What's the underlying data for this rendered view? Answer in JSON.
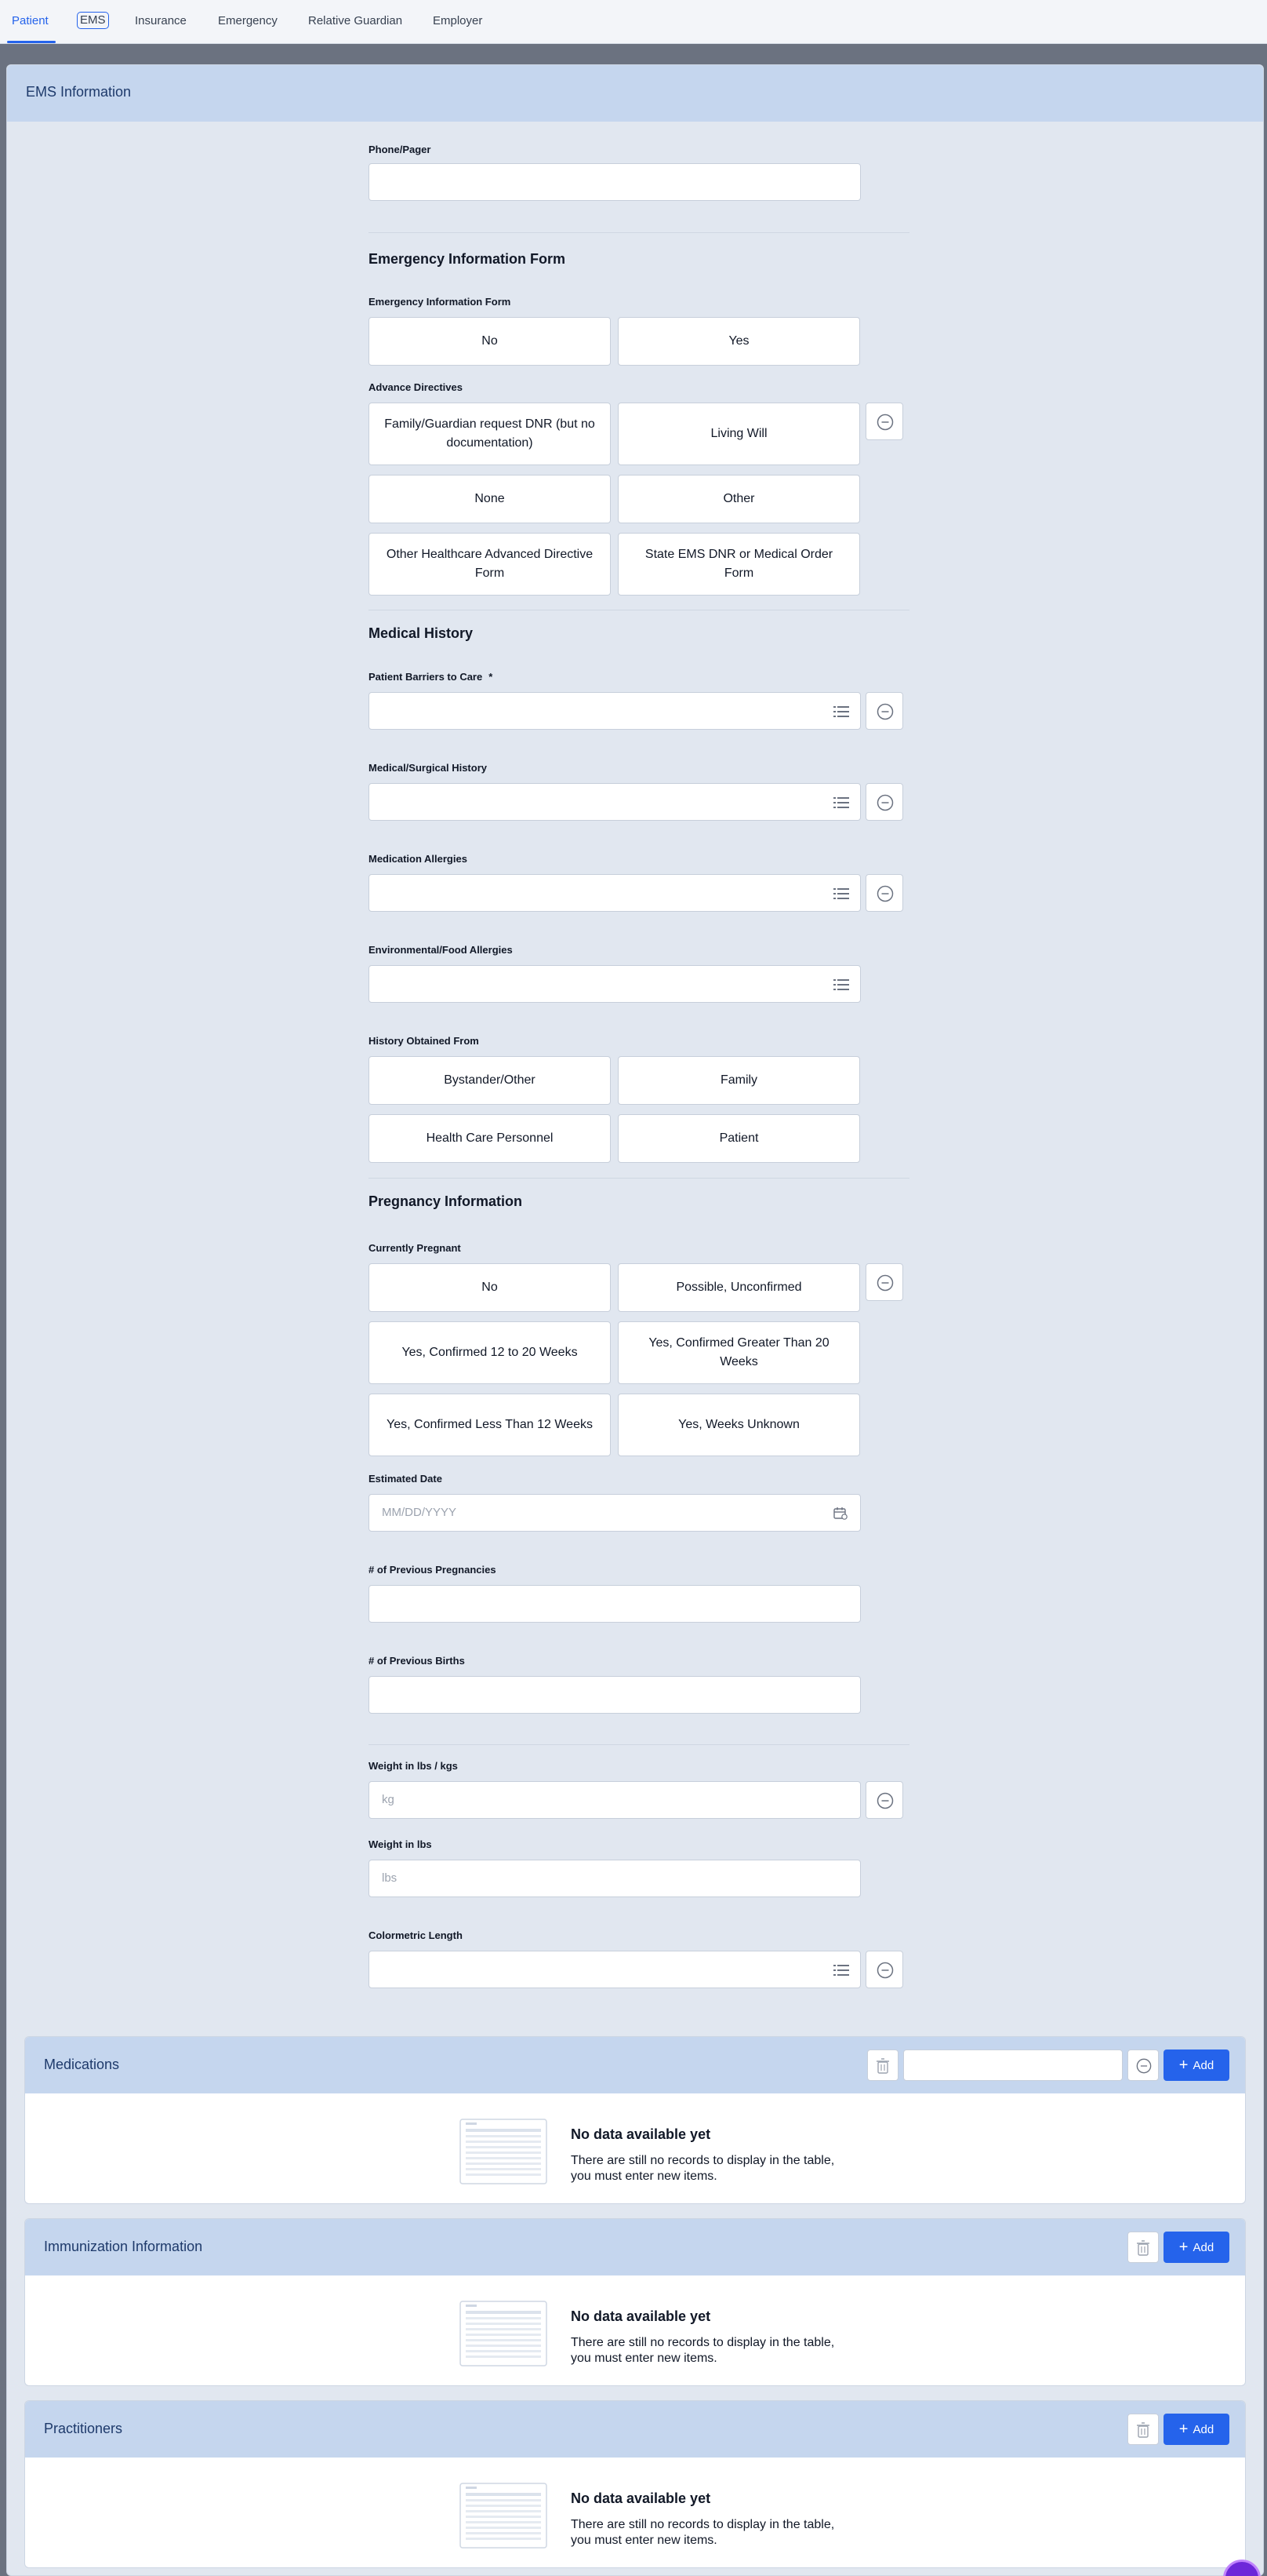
{
  "tabs": [
    "Patient",
    "EMS",
    "Insurance",
    "Emergency",
    "Relative Guardian",
    "Employer"
  ],
  "card_title": "EMS Information",
  "phone_label": "Phone/Pager",
  "eif_section": "Emergency Information Form",
  "eif_label": "Emergency Information Form",
  "eif_options": [
    "No",
    "Yes"
  ],
  "advance_label": "Advance Directives",
  "advance_options": [
    "Family/Guardian request DNR (but no documentation)",
    "Living Will",
    "None",
    "Other",
    "Other Healthcare Advanced Directive Form",
    "State EMS DNR or Medical Order Form"
  ],
  "medical_section": "Medical History",
  "barriers_label": "Patient Barriers to Care",
  "required_mark": "*",
  "surgical_label": "Medical/Surgical History",
  "allergies_label": "Medication Allergies",
  "env_label": "Environmental/Food Allergies",
  "obtained_label": "History Obtained From",
  "obtained_options": [
    "Bystander/Other",
    "Family",
    "Health Care Personnel",
    "Patient"
  ],
  "pregnancy_section": "Pregnancy Information",
  "pregnant_label": "Currently Pregnant",
  "pregnant_options": [
    "No",
    "Possible, Unconfirmed",
    "Yes, Confirmed 12 to 20 Weeks",
    "Yes, Confirmed Greater Than 20 Weeks",
    "Yes, Confirmed Less Than 12 Weeks",
    "Yes, Weeks Unknown"
  ],
  "est_date_label": "Estimated Date",
  "est_date_placeholder": "MM/DD/YYYY",
  "prev_preg_label": "# of Previous Pregnancies",
  "prev_births_label": "# of Previous Births",
  "weight_label": "Weight in lbs / kgs",
  "weight_placeholder": "kg",
  "weight_lbs_label": "Weight in lbs",
  "weight_lbs_placeholder": "lbs",
  "color_label": "Colormetric Length",
  "panels": [
    {
      "title": "Medications",
      "add_label": "Add",
      "empty_title": "No data available yet",
      "empty_desc": "There are still no records to display in the table, you must enter new items."
    },
    {
      "title": "Immunization Information",
      "add_label": "Add",
      "empty_title": "No data available yet",
      "empty_desc": "There are still no records to display in the table, you must enter new items."
    },
    {
      "title": "Practitioners",
      "add_label": "Add",
      "empty_title": "No data available yet",
      "empty_desc": "There are still no records to display in the table, you must enter new items."
    }
  ],
  "colors": {
    "accent": "#2563eb",
    "header_bg": "#c5d6ee",
    "card_bg": "#e1e7f0"
  }
}
